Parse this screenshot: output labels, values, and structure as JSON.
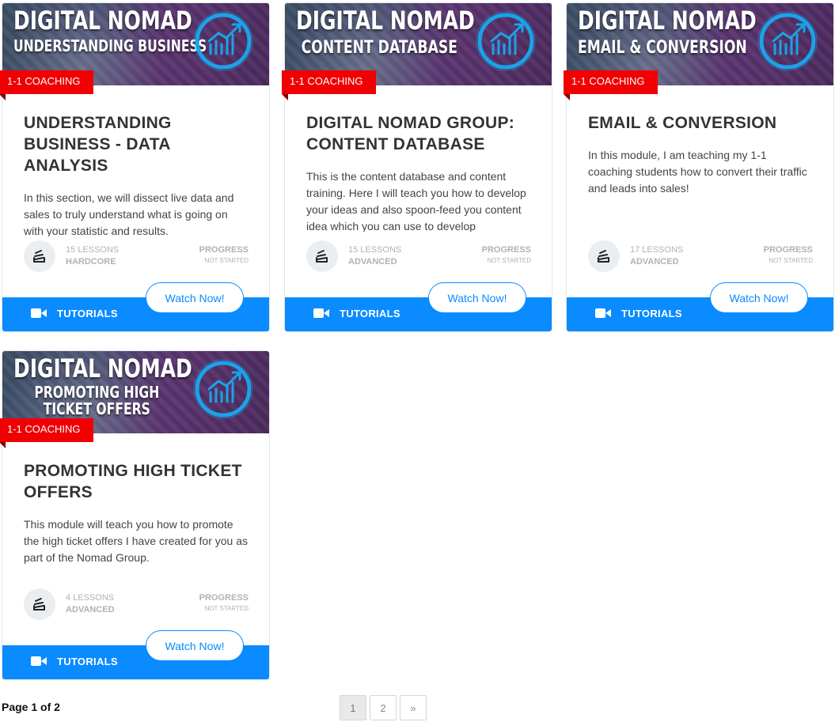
{
  "courses": [
    {
      "banner_line1": "DIGITAL NOMAD",
      "banner_line2": "UNDERSTANDING BUSINESS",
      "banner_line3": "",
      "badge": "1-1 COACHING",
      "title": "UNDERSTANDING BUSINESS - DATA ANALYSIS",
      "description": "In this section, we will dissect live data and sales to truly understand what is going on with your statistic and results.",
      "lessons": "15 LESSONS",
      "level": "HARDCORE",
      "progress_label": "PROGRESS",
      "progress_status": "NOT STARTED",
      "category": "TUTORIALS",
      "button": "Watch Now!"
    },
    {
      "banner_line1": "DIGITAL NOMAD",
      "banner_line2": "CONTENT DATABASE",
      "banner_line3": "",
      "badge": "1-1 COACHING",
      "title": "DIGITAL NOMAD GROUP: CONTENT DATABASE",
      "description": "This is the content database and content training. Here I will teach you how to develop your ideas and also spoon-feed you content idea which you can use to develop",
      "lessons": "15 LESSONS",
      "level": "ADVANCED",
      "progress_label": "PROGRESS",
      "progress_status": "NOT STARTED",
      "category": "TUTORIALS",
      "button": "Watch Now!"
    },
    {
      "banner_line1": "DIGITAL NOMAD",
      "banner_line2": "EMAIL & CONVERSION",
      "banner_line3": "",
      "badge": "1-1 COACHING",
      "title": "EMAIL & CONVERSION",
      "description": "In this module, I am teaching my 1-1 coaching students how to convert their traffic and leads into sales!",
      "lessons": "17 LESSONS",
      "level": "ADVANCED",
      "progress_label": "PROGRESS",
      "progress_status": "NOT STARTED",
      "category": "TUTORIALS",
      "button": "Watch Now!"
    },
    {
      "banner_line1": "DIGITAL NOMAD",
      "banner_line2": "PROMOTING HIGH",
      "banner_line3": "TICKET OFFERS",
      "badge": "1-1 COACHING",
      "title": "PROMOTING HIGH TICKET OFFERS",
      "description": "This module will teach you how to promote the high ticket offers I have created for you as part of the Nomad Group.",
      "lessons": "4 LESSONS",
      "level": "ADVANCED",
      "progress_label": "PROGRESS",
      "progress_status": "NOT STARTED",
      "category": "TUTORIALS",
      "button": "Watch Now!"
    }
  ],
  "icons": {
    "meta": "stack-icon",
    "footer": "video-camera-icon",
    "banner": "growth-chart-icon"
  },
  "colors": {
    "accent": "#0a8bff",
    "badge": "#f00000"
  },
  "pagination": {
    "info": "Page 1 of 2",
    "pages": [
      "1",
      "2"
    ],
    "next": "»",
    "current": "1"
  }
}
